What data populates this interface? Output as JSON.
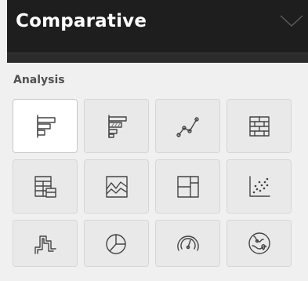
{
  "header": {
    "title": "Comparative"
  },
  "section": {
    "title": "Analysis"
  },
  "tiles": [
    {
      "icon": "bar-chart-icon",
      "selected": true
    },
    {
      "icon": "bar-chart-highlighted-icon",
      "selected": false
    },
    {
      "icon": "line-chart-icon",
      "selected": false
    },
    {
      "icon": "brick-grid-icon",
      "selected": false
    },
    {
      "icon": "table-grid-icon",
      "selected": false
    },
    {
      "icon": "area-chart-icon",
      "selected": false
    },
    {
      "icon": "treemap-icon",
      "selected": false
    },
    {
      "icon": "scatter-plot-icon",
      "selected": false
    },
    {
      "icon": "step-chart-icon",
      "selected": false
    },
    {
      "icon": "pie-chart-icon",
      "selected": false
    },
    {
      "icon": "gauge-icon",
      "selected": false
    },
    {
      "icon": "map-icon",
      "selected": false
    }
  ],
  "colors": {
    "header_bg": "#1e1e1e",
    "panel_bg": "#f0f0f0",
    "tile_bg": "#e9e9e9"
  }
}
